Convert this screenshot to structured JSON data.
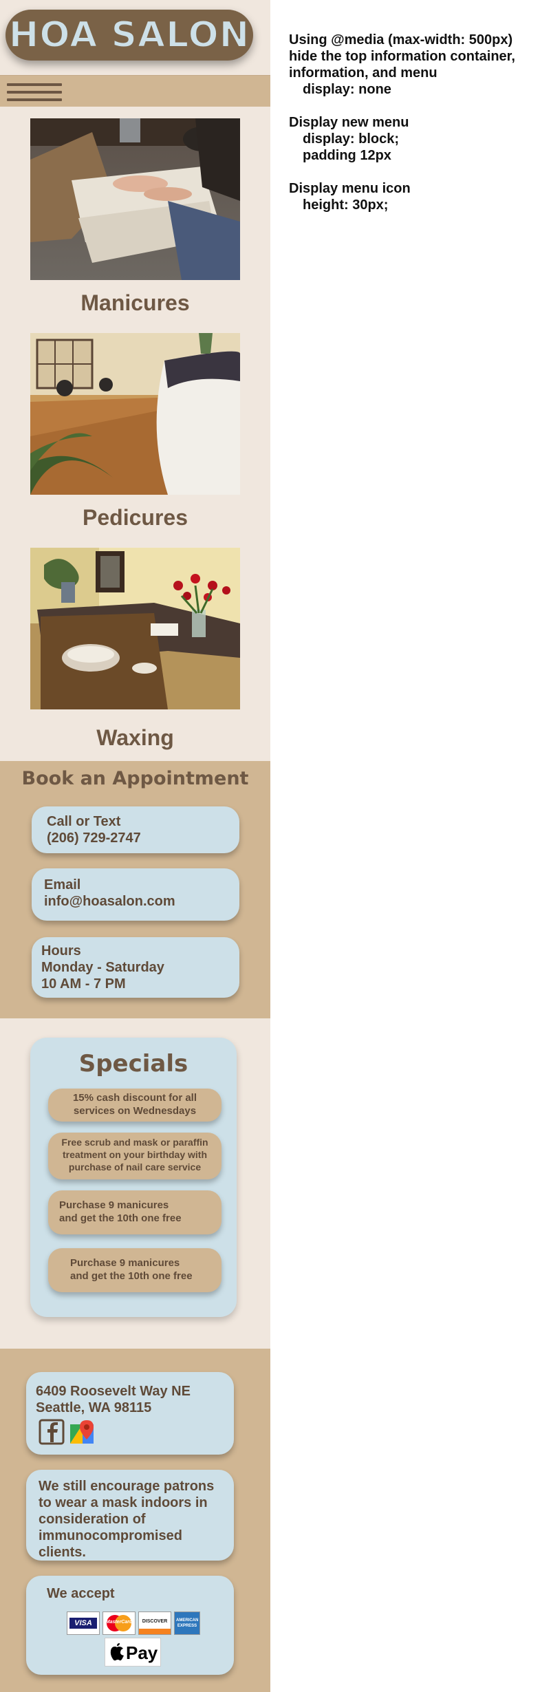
{
  "header": {
    "brand": "HOA SALON"
  },
  "services": [
    {
      "title": "Manicures"
    },
    {
      "title": "Pedicures"
    },
    {
      "title": "Waxing"
    }
  ],
  "booking": {
    "heading": "Book an Appointment",
    "call": {
      "label": "Call or Text",
      "value": "(206) 729-2747"
    },
    "email": {
      "label": "Email",
      "value": "info@hoasalon.com"
    },
    "hours": {
      "label": "Hours",
      "days": "Monday - Saturday",
      "time": "10 AM - 7 PM"
    }
  },
  "specials": {
    "heading": "Specials",
    "items": [
      {
        "l1": "15% cash discount for all",
        "l2": "services on Wednesdays"
      },
      {
        "l1": "Free scrub and mask or paraffin",
        "l2": "treatment on your birthday with",
        "l3": "purchase of nail care service"
      },
      {
        "l1": "Purchase 9 manicures",
        "l2": "and get the 10th one free"
      },
      {
        "l1": "Purchase 9 manicures",
        "l2": "and get the 10th one free"
      }
    ]
  },
  "footer": {
    "address_line1": "6409 Roosevelt Way NE",
    "address_line2": "Seattle, WA 98115",
    "notice": [
      "We still encourage patrons",
      "to wear a mask indoors in",
      "consideration of",
      "immunocompromised",
      "clients."
    ],
    "accept_label": "We accept",
    "cards": {
      "visa": "VISA",
      "mastercard": "MasterCard",
      "discover": "DISCOVER",
      "amex": "AMERICAN EXPRESS",
      "applepay": "Pay"
    }
  },
  "notes": {
    "line1": "Using @media (max-width: 500px)",
    "line2": "hide the top information container,",
    "line3": "information, and menu",
    "line4": "display: none",
    "line5": "Display new menu",
    "line6": "display: block;",
    "line7": "padding 12px",
    "line8": "Display menu icon",
    "line9": "height: 30px;"
  },
  "colors": {
    "beige": "#f0e7de",
    "tan": "#d0b693",
    "brown": "#6e5844",
    "lightblue": "#cde0e8"
  },
  "icons": [
    "menu-icon",
    "facebook-icon",
    "map-icon",
    "visa-icon",
    "mastercard-icon",
    "discover-icon",
    "amex-icon",
    "apple-pay-icon"
  ]
}
